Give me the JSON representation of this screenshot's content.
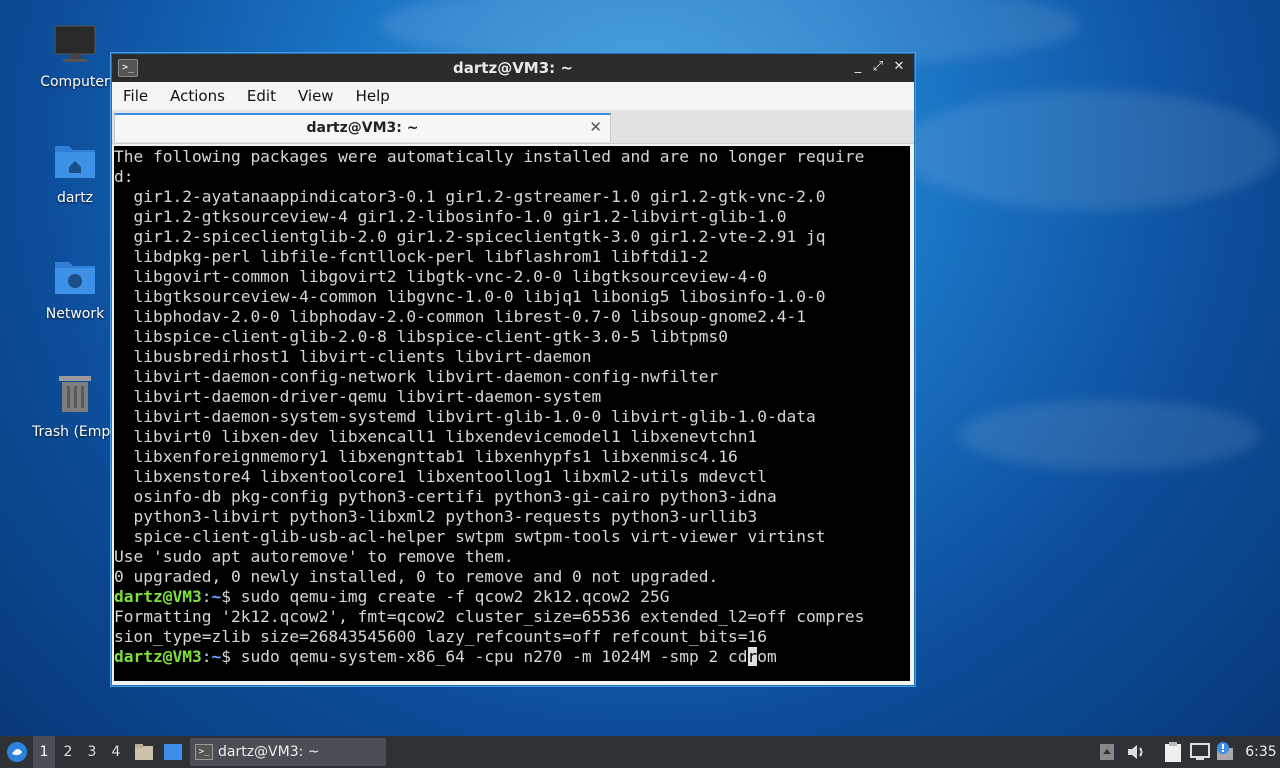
{
  "desktop": {
    "icons": [
      {
        "label": "Computer",
        "icon": "monitor-icon"
      },
      {
        "label": "dartz",
        "icon": "home-folder-icon"
      },
      {
        "label": "Network",
        "icon": "network-folder-icon"
      },
      {
        "label": "Trash (Empty)",
        "icon": "trash-icon"
      }
    ]
  },
  "window": {
    "title": "dartz@VM3: ~",
    "menu": [
      "File",
      "Actions",
      "Edit",
      "View",
      "Help"
    ],
    "tab_title": "dartz@VM3: ~",
    "buttons": {
      "minimize": "_",
      "maximize": "⤢",
      "close": "✕"
    }
  },
  "terminal": {
    "lines": [
      "The following packages were automatically installed and are no longer require",
      "d:",
      "  gir1.2-ayatanaappindicator3-0.1 gir1.2-gstreamer-1.0 gir1.2-gtk-vnc-2.0",
      "  gir1.2-gtksourceview-4 gir1.2-libosinfo-1.0 gir1.2-libvirt-glib-1.0",
      "  gir1.2-spiceclientglib-2.0 gir1.2-spiceclientgtk-3.0 gir1.2-vte-2.91 jq",
      "  libdpkg-perl libfile-fcntllock-perl libflashrom1 libftdi1-2",
      "  libgovirt-common libgovirt2 libgtk-vnc-2.0-0 libgtksourceview-4-0",
      "  libgtksourceview-4-common libgvnc-1.0-0 libjq1 libonig5 libosinfo-1.0-0",
      "  libphodav-2.0-0 libphodav-2.0-common librest-0.7-0 libsoup-gnome2.4-1",
      "  libspice-client-glib-2.0-8 libspice-client-gtk-3.0-5 libtpms0",
      "  libusbredirhost1 libvirt-clients libvirt-daemon",
      "  libvirt-daemon-config-network libvirt-daemon-config-nwfilter",
      "  libvirt-daemon-driver-qemu libvirt-daemon-system",
      "  libvirt-daemon-system-systemd libvirt-glib-1.0-0 libvirt-glib-1.0-data",
      "  libvirt0 libxen-dev libxencall1 libxendevicemodel1 libxenevtchn1",
      "  libxenforeignmemory1 libxengnttab1 libxenhypfs1 libxenmisc4.16",
      "  libxenstore4 libxentoolcore1 libxentoollog1 libxml2-utils mdevctl",
      "  osinfo-db pkg-config python3-certifi python3-gi-cairo python3-idna",
      "  python3-libvirt python3-libxml2 python3-requests python3-urllib3",
      "  spice-client-glib-usb-acl-helper swtpm swtpm-tools virt-viewer virtinst",
      "Use 'sudo apt autoremove' to remove them.",
      "0 upgraded, 0 newly installed, 0 to remove and 0 not upgraded."
    ],
    "prompt_user": "dartz@VM3",
    "prompt_sep": ":",
    "prompt_path": "~",
    "prompt_dollar": "$ ",
    "cmd1": "sudo qemu-img create -f qcow2 2k12.qcow2 25G",
    "out1": "Formatting '2k12.qcow2', fmt=qcow2 cluster_size=65536 extended_l2=off compres",
    "out2": "sion_type=zlib size=26843545600 lazy_refcounts=off refcount_bits=16",
    "cmd2_before": "sudo qemu-system-x86_64 -cpu n270 -m 1024M -smp 2 cd",
    "cmd2_cursor": "r",
    "cmd2_after": "om"
  },
  "taskbar": {
    "workspaces": [
      "1",
      "2",
      "3",
      "4"
    ],
    "active_workspace": "1",
    "task_label": "dartz@VM3: ~",
    "clock": "6:35"
  },
  "colors": {
    "prompt_user": "#7fe03a",
    "prompt_path": "#6fa8ff",
    "accent": "#3a8fe0"
  }
}
